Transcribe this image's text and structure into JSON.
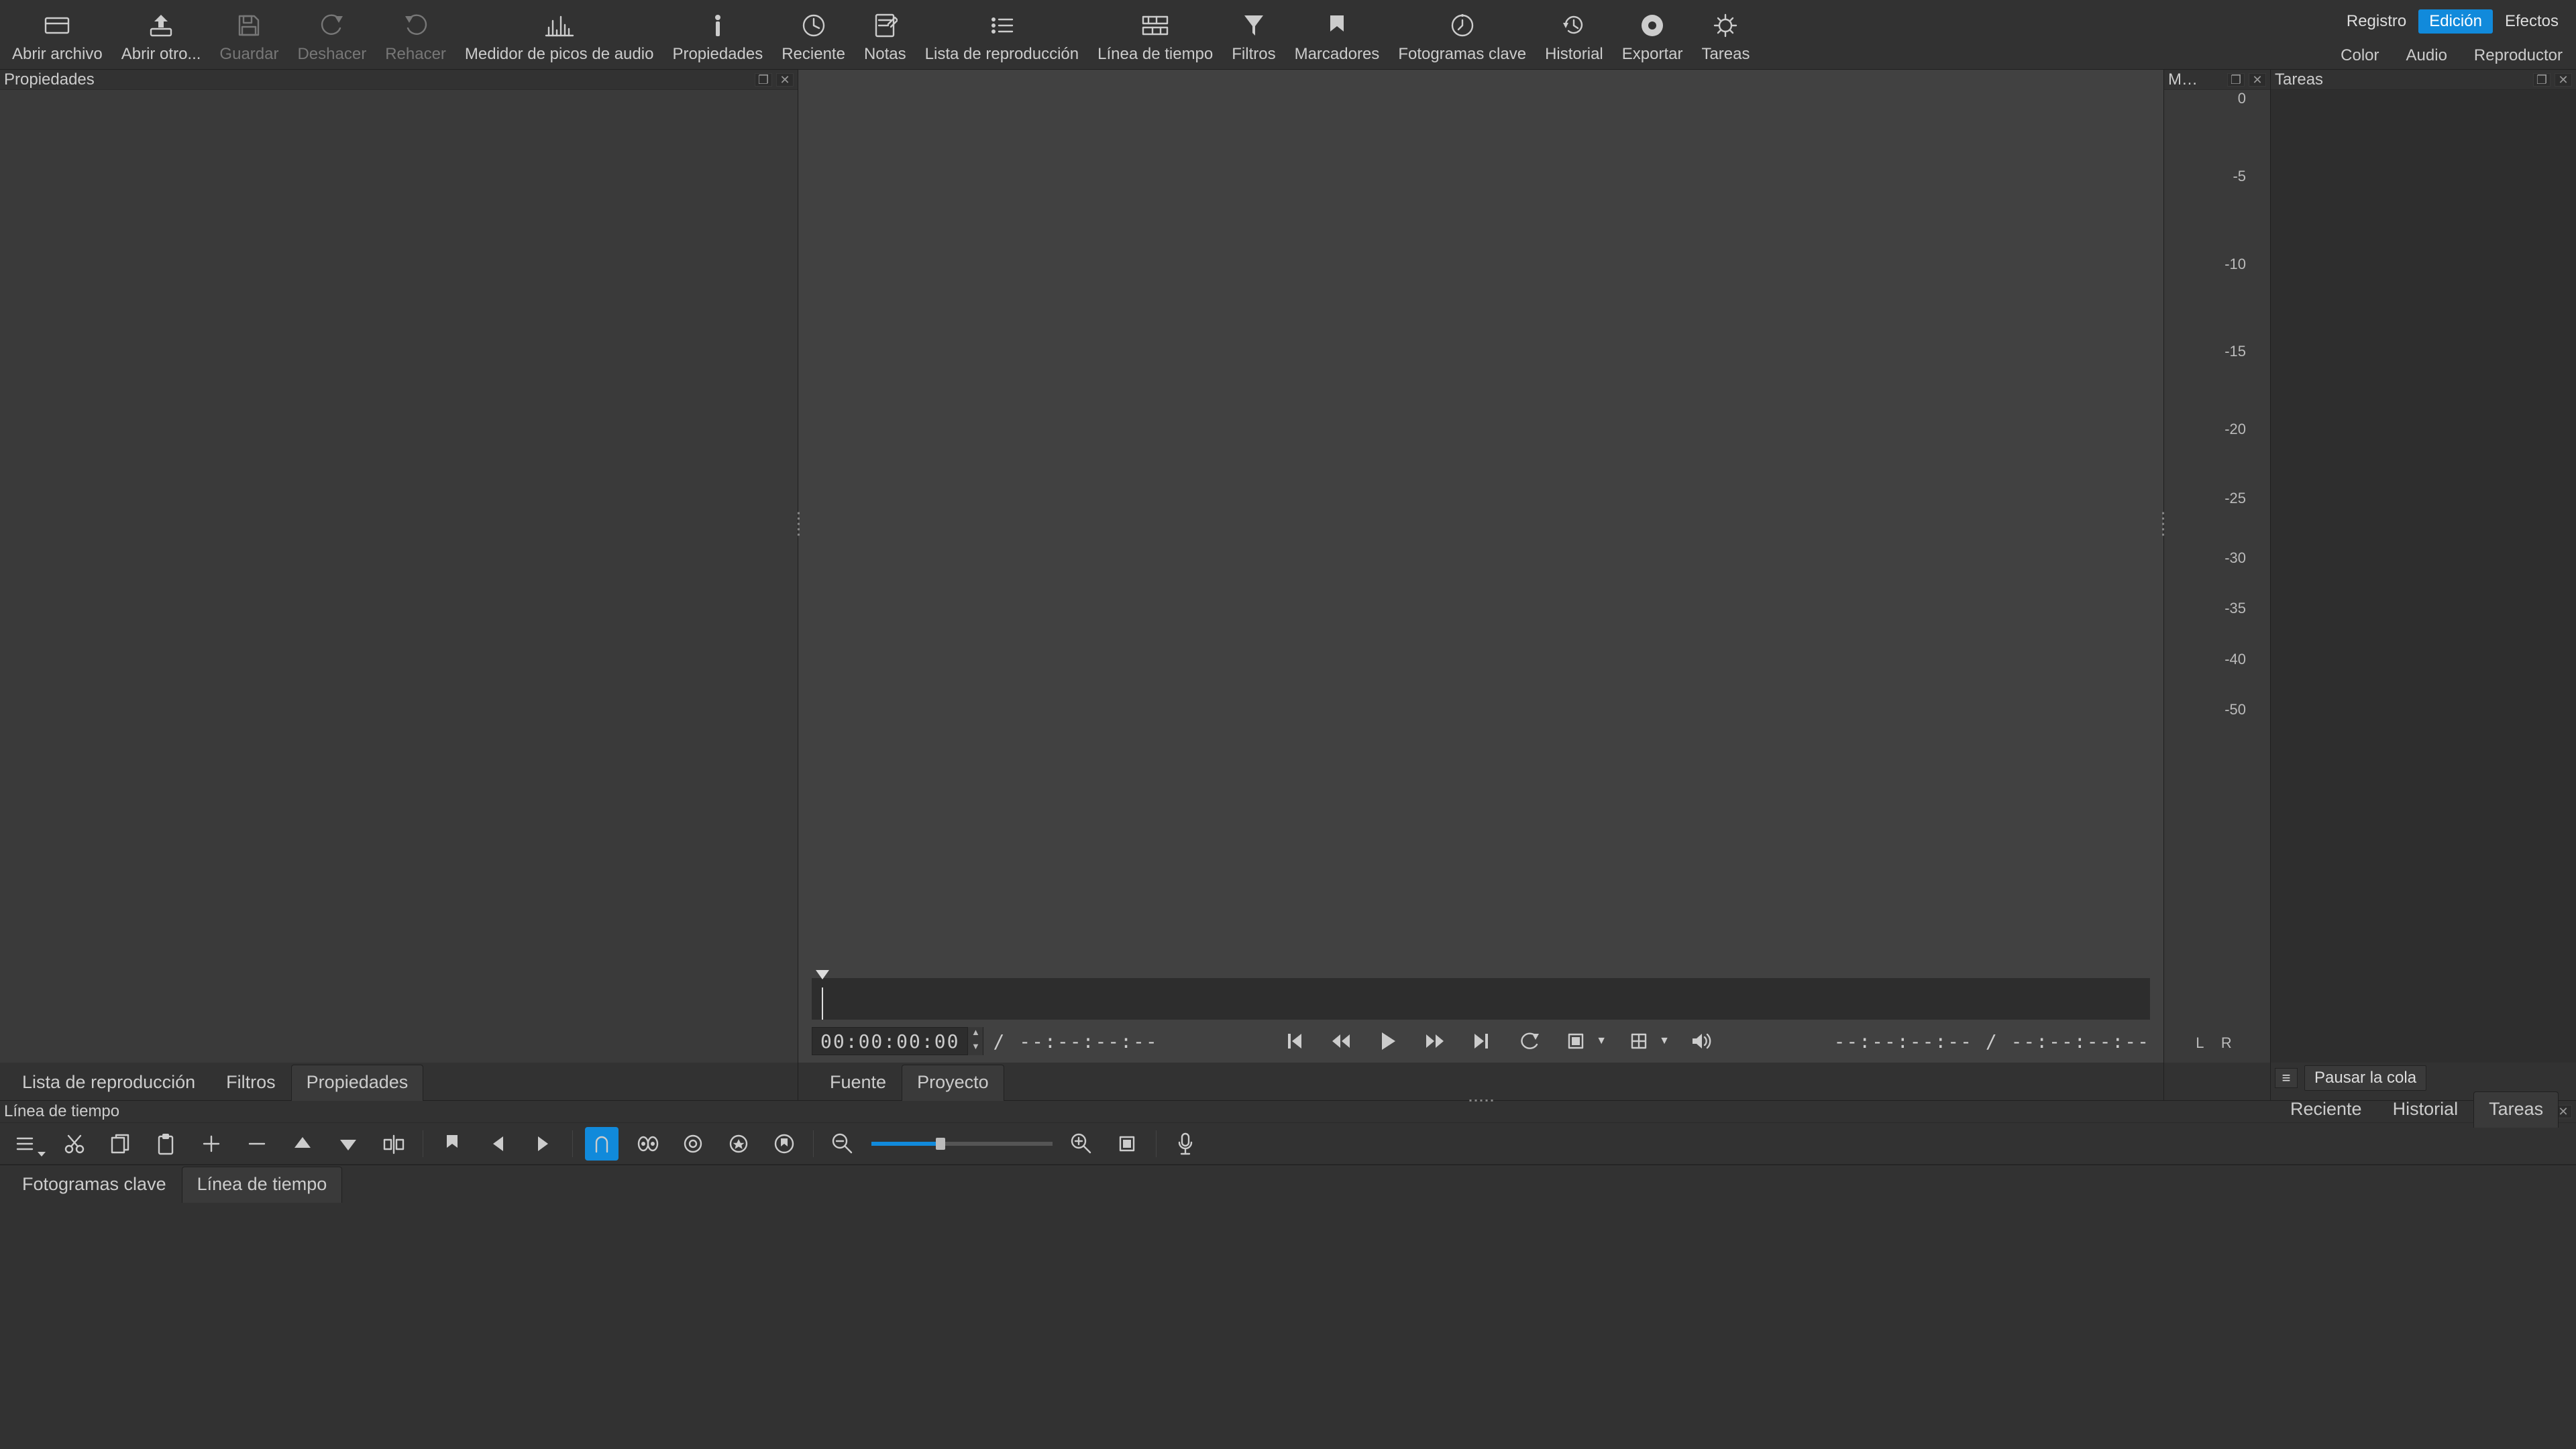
{
  "toolbar": [
    {
      "id": "open",
      "label": "Abrir archivo"
    },
    {
      "id": "open-other",
      "label": "Abrir otro..."
    },
    {
      "id": "save",
      "label": "Guardar",
      "disabled": true
    },
    {
      "id": "undo",
      "label": "Deshacer",
      "disabled": true
    },
    {
      "id": "redo",
      "label": "Rehacer",
      "disabled": true
    },
    {
      "id": "peak",
      "label": "Medidor de picos de audio"
    },
    {
      "id": "props",
      "label": "Propiedades"
    },
    {
      "id": "recent",
      "label": "Reciente"
    },
    {
      "id": "notes",
      "label": "Notas"
    },
    {
      "id": "playlist",
      "label": "Lista de reproducción"
    },
    {
      "id": "timeline",
      "label": "Línea de tiempo"
    },
    {
      "id": "filters",
      "label": "Filtros"
    },
    {
      "id": "markers",
      "label": "Marcadores"
    },
    {
      "id": "keyframes",
      "label": "Fotogramas clave"
    },
    {
      "id": "history",
      "label": "Historial"
    },
    {
      "id": "export",
      "label": "Exportar"
    },
    {
      "id": "jobs",
      "label": "Tareas"
    }
  ],
  "layoutTabs": {
    "logging": "Registro",
    "editing": "Edición",
    "effects": "Efectos",
    "active": "editing"
  },
  "layoutLinks": {
    "color": "Color",
    "audio": "Audio",
    "player": "Reproductor"
  },
  "leftPanel": {
    "title": "Propiedades"
  },
  "meterPanel": {
    "title": "M…",
    "ticks": [
      "0",
      "-5",
      "-10",
      "-15",
      "-20",
      "-25",
      "-30",
      "-35",
      "-40",
      "-50"
    ],
    "lr": "L  R"
  },
  "tasksPanel": {
    "title": "Tareas",
    "menu": "≡",
    "pause": "Pausar la cola",
    "tabs": {
      "recent": "Reciente",
      "history": "Historial",
      "jobs": "Tareas",
      "active": "jobs"
    }
  },
  "transport": {
    "tc": "00:00:00:00",
    "sep": "/",
    "dur": "--:--:--:--",
    "inout": "--:--:--:--  /  --:--:--:--",
    "tickPcts": [
      0,
      8.5,
      18,
      27.5,
      36,
      43.5,
      50,
      55.5,
      61,
      66.5
    ]
  },
  "sourceTabs": {
    "source": "Fuente",
    "project": "Proyecto",
    "active": "project"
  },
  "leftTabs": {
    "playlist": "Lista de reproducción",
    "filters": "Filtros",
    "properties": "Propiedades",
    "active": "properties"
  },
  "timeline": {
    "title": "Línea de tiempo",
    "zoomPct": 38
  },
  "bottomTabs": {
    "keyframes": "Fotogramas clave",
    "timeline": "Línea de tiempo",
    "active": "timeline"
  }
}
